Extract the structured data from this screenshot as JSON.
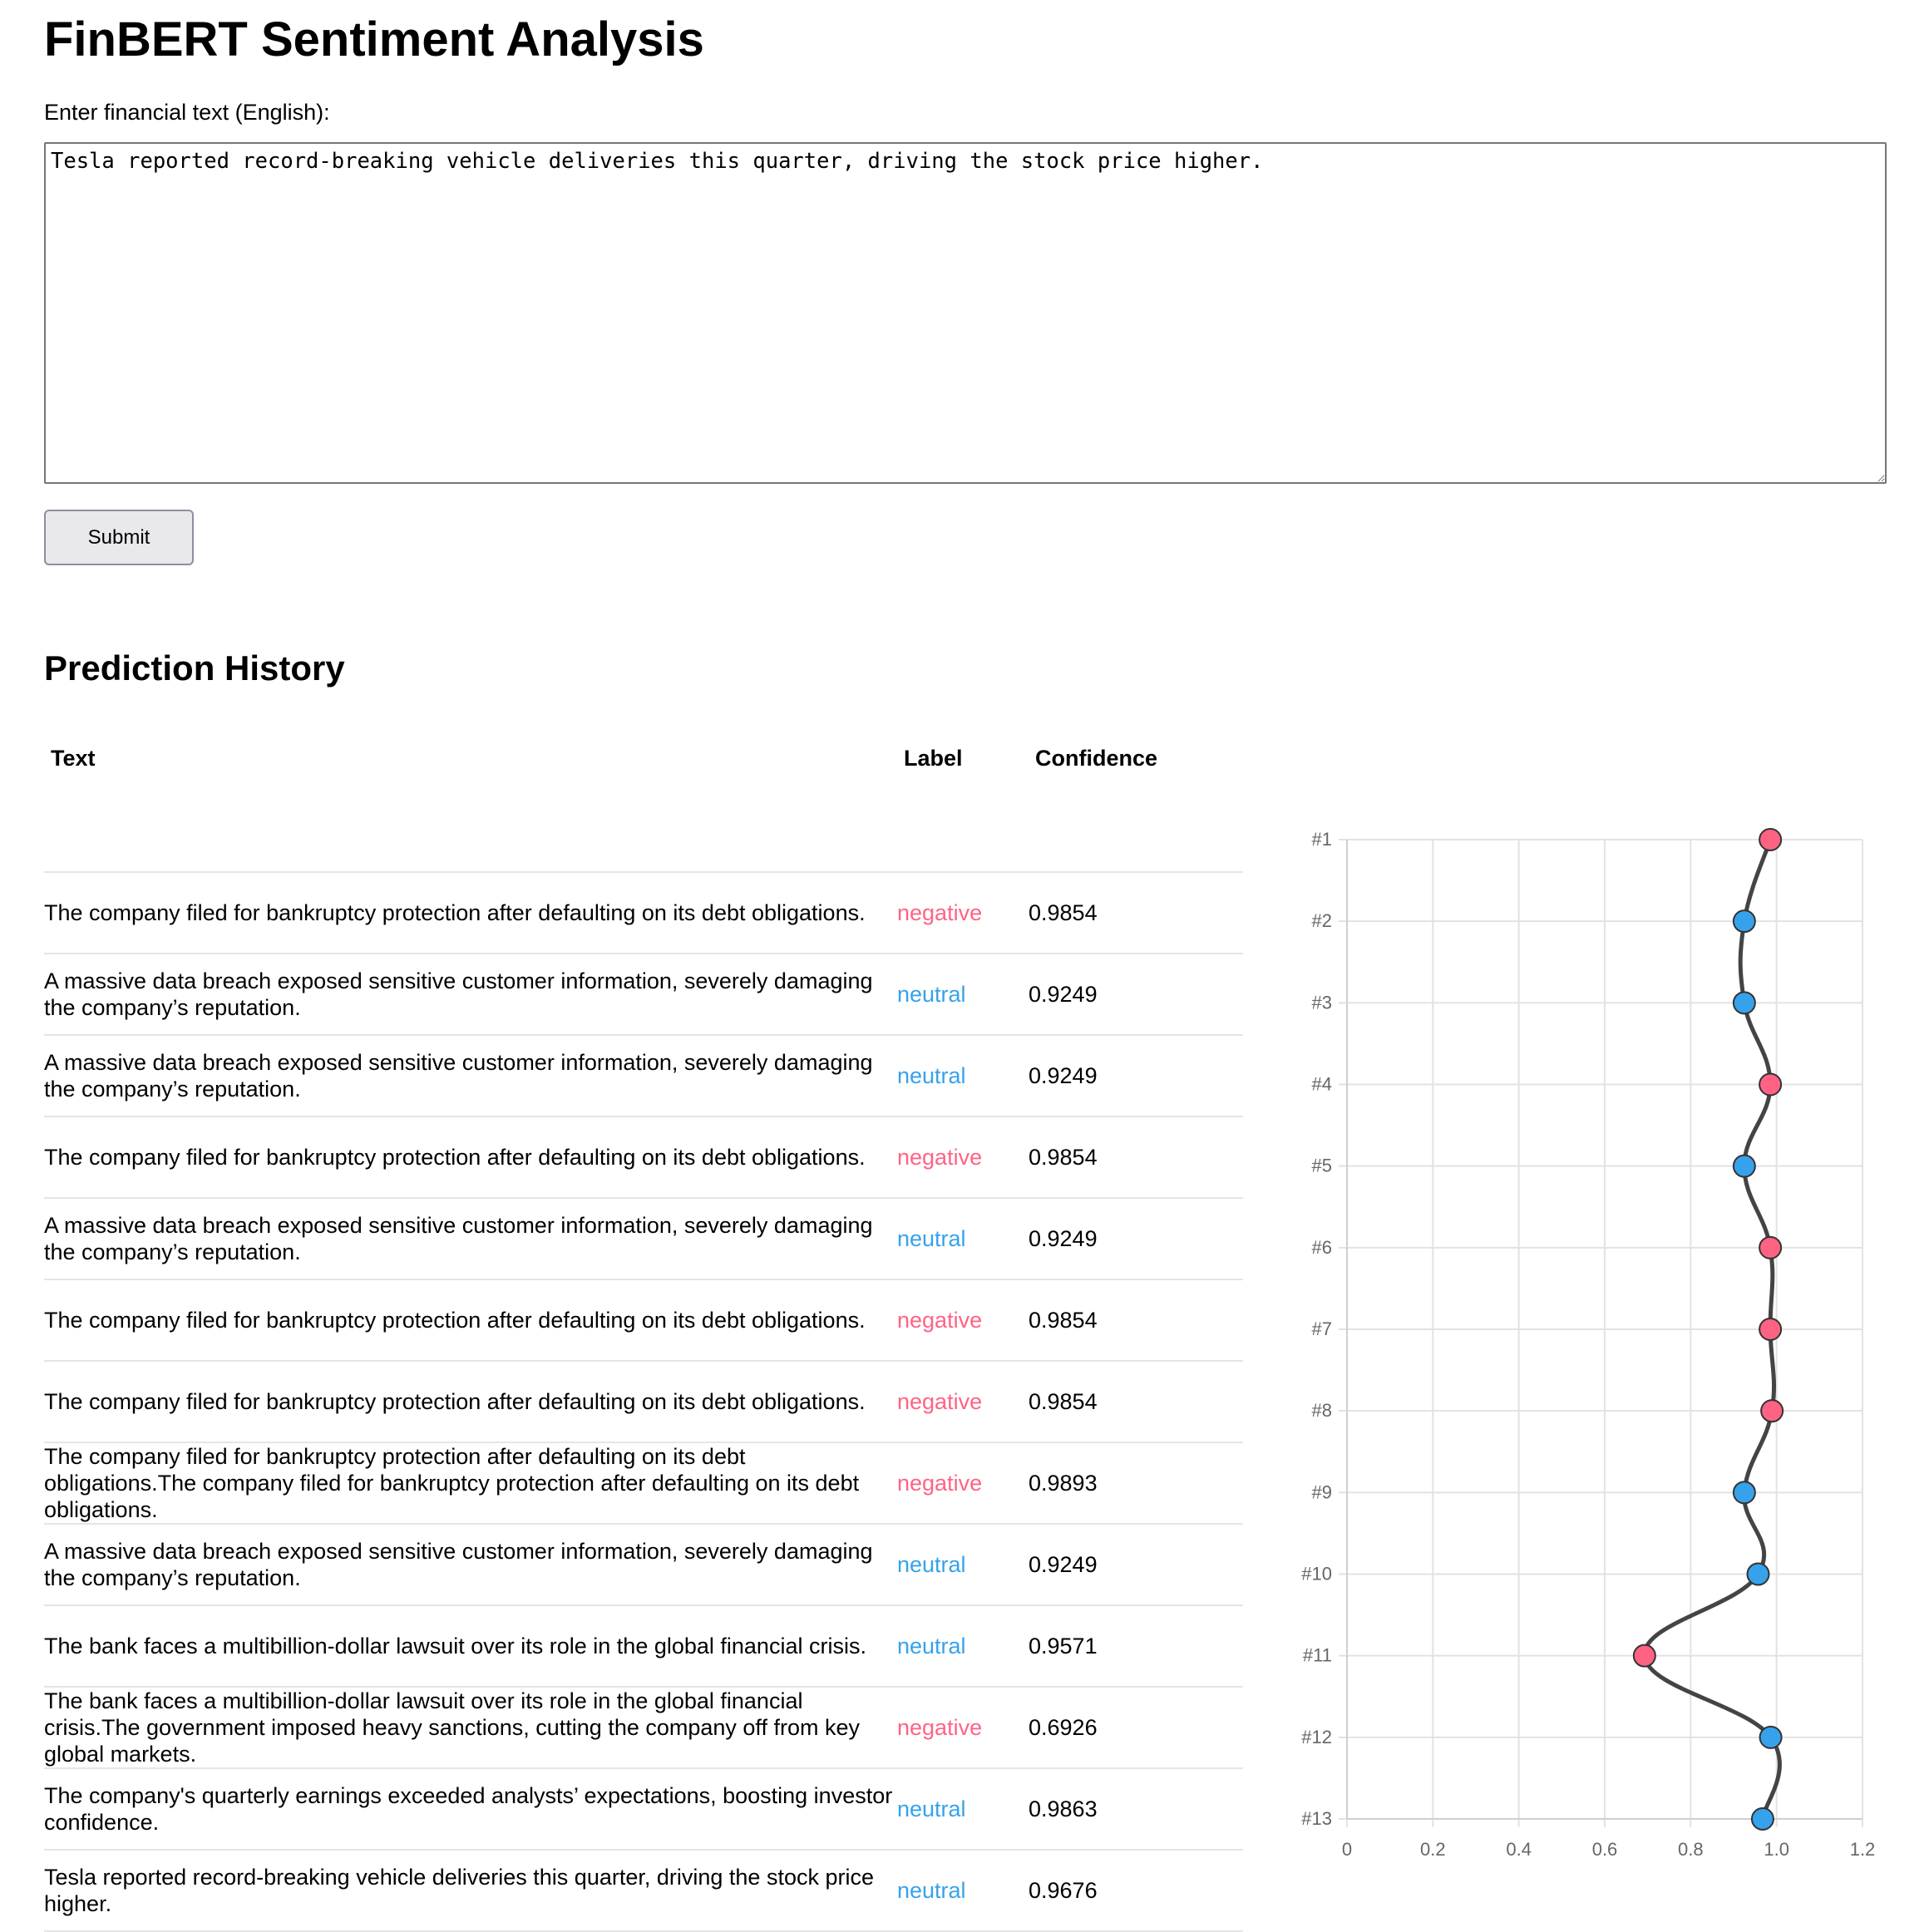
{
  "page": {
    "title": "FinBERT Sentiment Analysis",
    "input_label": "Enter financial text (English):",
    "input_value": "Tesla reported record-breaking vehicle deliveries this quarter, driving the stock price higher.",
    "submit_label": "Submit",
    "history_title": "Prediction History"
  },
  "table": {
    "headers": {
      "text": "Text",
      "label": "Label",
      "confidence": "Confidence"
    },
    "rows": [
      {
        "text": "The company filed for bankruptcy protection after defaulting on its debt obligations.",
        "label": "negative",
        "confidence": "0.9854"
      },
      {
        "text": "A massive data breach exposed sensitive customer information, severely damaging the company’s reputation.",
        "label": "neutral",
        "confidence": "0.9249"
      },
      {
        "text": "A massive data breach exposed sensitive customer information, severely damaging the company’s reputation.",
        "label": "neutral",
        "confidence": "0.9249"
      },
      {
        "text": "The company filed for bankruptcy protection after defaulting on its debt obligations.",
        "label": "negative",
        "confidence": "0.9854"
      },
      {
        "text": "A massive data breach exposed sensitive customer information, severely damaging the company’s reputation.",
        "label": "neutral",
        "confidence": "0.9249"
      },
      {
        "text": "The company filed for bankruptcy protection after defaulting on its debt obligations.",
        "label": "negative",
        "confidence": "0.9854"
      },
      {
        "text": "The company filed for bankruptcy protection after defaulting on its debt obligations.",
        "label": "negative",
        "confidence": "0.9854"
      },
      {
        "text": "The company filed for bankruptcy protection after defaulting on its debt obligations.The company filed for bankruptcy protection after defaulting on its debt obligations.",
        "label": "negative",
        "confidence": "0.9893"
      },
      {
        "text": "A massive data breach exposed sensitive customer information, severely damaging the company’s reputation.",
        "label": "neutral",
        "confidence": "0.9249"
      },
      {
        "text": "The bank faces a multibillion-dollar lawsuit over its role in the global financial crisis.",
        "label": "neutral",
        "confidence": "0.9571"
      },
      {
        "text": "The bank faces a multibillion-dollar lawsuit over its role in the global financial crisis.The government imposed heavy sanctions, cutting the company off from key global markets.",
        "label": "negative",
        "confidence": "0.6926"
      },
      {
        "text": "The company's quarterly earnings exceeded analysts’ expectations, boosting investor confidence.",
        "label": "neutral",
        "confidence": "0.9863"
      },
      {
        "text": "Tesla reported record-breaking vehicle deliveries this quarter, driving the stock price higher.",
        "label": "neutral",
        "confidence": "0.9676"
      }
    ]
  },
  "colors": {
    "negative": "#ff6384",
    "neutral": "#36a2eb",
    "line": "#444444",
    "grid": "#e2e2e2"
  },
  "chart_data": {
    "type": "line",
    "orientation": "vertical",
    "categories": [
      "#1",
      "#2",
      "#3",
      "#4",
      "#5",
      "#6",
      "#7",
      "#8",
      "#9",
      "#10",
      "#11",
      "#12",
      "#13"
    ],
    "values": [
      0.9854,
      0.9249,
      0.9249,
      0.9854,
      0.9249,
      0.9854,
      0.9854,
      0.9893,
      0.9249,
      0.9571,
      0.6926,
      0.9863,
      0.9676
    ],
    "point_labels": [
      "negative",
      "neutral",
      "neutral",
      "negative",
      "neutral",
      "negative",
      "negative",
      "negative",
      "neutral",
      "neutral",
      "negative",
      "neutral",
      "neutral"
    ],
    "xlim": [
      0,
      1.2
    ],
    "xticks": [
      "0",
      "0.2",
      "0.4",
      "0.6",
      "0.8",
      "1.0",
      "1.2"
    ],
    "grid": true,
    "title": "",
    "xlabel": "",
    "ylabel": ""
  }
}
